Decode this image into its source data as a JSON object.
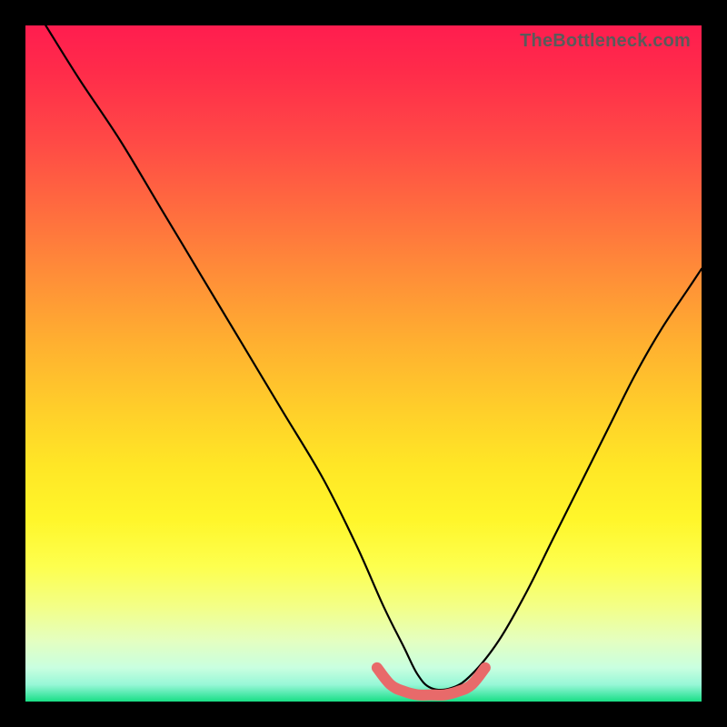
{
  "watermark": "TheBottleneck.com",
  "chart_data": {
    "type": "line",
    "title": "",
    "xlabel": "",
    "ylabel": "",
    "xlim": [
      0,
      100
    ],
    "ylim": [
      0,
      100
    ],
    "grid": false,
    "legend": false,
    "annotations": [],
    "series": [
      {
        "name": "black-curve",
        "color": "#000000",
        "x": [
          3,
          8,
          14,
          20,
          26,
          32,
          38,
          44,
          49,
          53,
          56,
          58,
          60,
          63,
          66,
          70,
          74,
          78,
          82,
          86,
          90,
          94,
          98,
          100
        ],
        "y": [
          100,
          92,
          83,
          73,
          63,
          53,
          43,
          33,
          23,
          14,
          8,
          4,
          2,
          2,
          4,
          9,
          16,
          24,
          32,
          40,
          48,
          55,
          61,
          64
        ]
      },
      {
        "name": "pink-valley-highlight",
        "color": "#e86a6a",
        "x": [
          52,
          54,
          56,
          58,
          60,
          62,
          64,
          66,
          68
        ],
        "y": [
          5,
          2.5,
          1.5,
          1,
          1,
          1,
          1.5,
          2.5,
          5
        ]
      }
    ],
    "background_gradient_stops": [
      {
        "pct": 0,
        "color": "#ff1d4f"
      },
      {
        "pct": 27,
        "color": "#ff6b3f"
      },
      {
        "pct": 57,
        "color": "#ffcf2a"
      },
      {
        "pct": 80,
        "color": "#fdff4e"
      },
      {
        "pct": 95,
        "color": "#c9ffe0"
      },
      {
        "pct": 100,
        "color": "#19df85"
      }
    ]
  }
}
